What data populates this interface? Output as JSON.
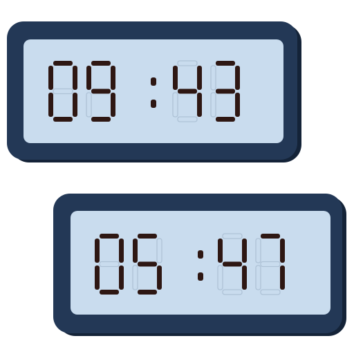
{
  "clocks": [
    {
      "time": "09:43",
      "colors": {
        "frame": "#233856",
        "frame_shadow": "#142338",
        "screen": "#c9dcee",
        "segment_on": "#2e1713",
        "segment_off": "#aec2d6"
      }
    },
    {
      "time": "05:47",
      "colors": {
        "frame": "#233856",
        "frame_shadow": "#142338",
        "screen": "#c9dcee",
        "segment_on": "#2e1713",
        "segment_off": "#aec2d6"
      }
    }
  ]
}
